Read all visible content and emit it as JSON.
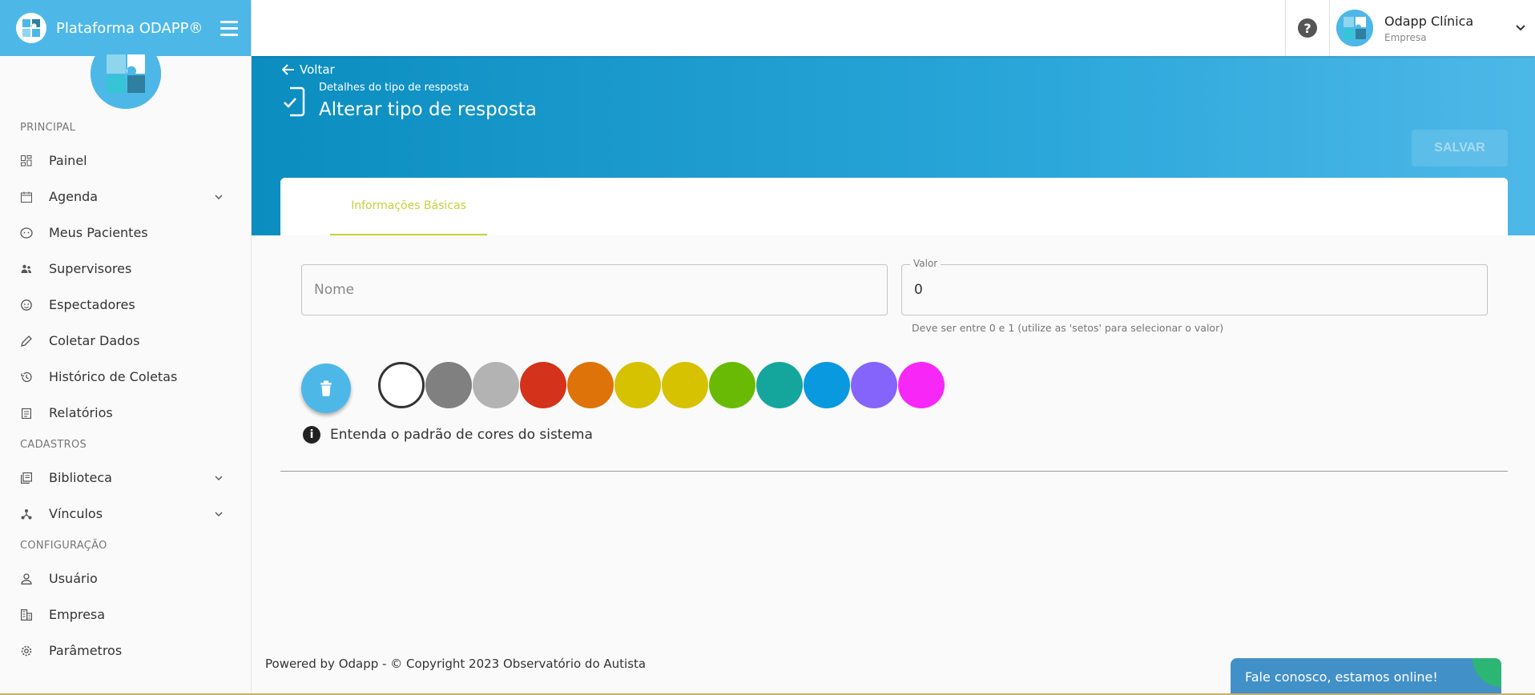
{
  "brand": {
    "title": "Plataforma ODAPP®"
  },
  "sidebar": {
    "sections": [
      {
        "title": "PRINCIPAL",
        "items": [
          {
            "label": "Painel",
            "icon": "dashboard-icon",
            "expandable": false
          },
          {
            "label": "Agenda",
            "icon": "calendar-icon",
            "expandable": true
          },
          {
            "label": "Meus Pacientes",
            "icon": "face-icon",
            "expandable": false
          },
          {
            "label": "Supervisores",
            "icon": "people-icon",
            "expandable": false
          },
          {
            "label": "Espectadores",
            "icon": "smile-icon",
            "expandable": false
          },
          {
            "label": "Coletar Dados",
            "icon": "pencil-icon",
            "expandable": false
          },
          {
            "label": "Histórico de Coletas",
            "icon": "history-icon",
            "expandable": false
          },
          {
            "label": "Relatórios",
            "icon": "report-icon",
            "expandable": false
          }
        ]
      },
      {
        "title": "CADASTROS",
        "items": [
          {
            "label": "Biblioteca",
            "icon": "library-icon",
            "expandable": true
          },
          {
            "label": "Vínculos",
            "icon": "hub-icon",
            "expandable": true
          }
        ]
      },
      {
        "title": "CONFIGURAÇÃO",
        "items": [
          {
            "label": "Usuário",
            "icon": "user-icon",
            "expandable": false
          },
          {
            "label": "Empresa",
            "icon": "building-icon",
            "expandable": false
          },
          {
            "label": "Parâmetros",
            "icon": "gear-icon",
            "expandable": false
          }
        ]
      }
    ]
  },
  "topbar": {
    "help": "?",
    "user_name": "Odapp Clínica",
    "user_role": "Empresa"
  },
  "header": {
    "back_label": "Voltar",
    "subtitle": "Detalhes do tipo de resposta",
    "title": "Alterar tipo de resposta",
    "save_label": "SALVAR"
  },
  "form": {
    "tab_label": "Informações Básicas",
    "name_placeholder": "Nome",
    "name_value": "",
    "valor_legend": "Valor",
    "valor_value": "0",
    "valor_help": "Deve ser entre 0 e 1 (utilize as 'setos' para selecionar o valor)",
    "info_label": "Entenda o padrão de cores do sistema",
    "info_glyph": "i"
  },
  "colors": {
    "accent": "#4db8e8",
    "tab_active": "#c4d23a",
    "swatches": [
      "#ffffff",
      "#808080",
      "#b3b3b3",
      "#d4321a",
      "#de7309",
      "#d6c201",
      "#d6c201",
      "#69ba04",
      "#14a69c",
      "#0999df",
      "#8564fb",
      "#f728f7"
    ]
  },
  "footer": {
    "text": "Powered by Odapp - © Copyright 2023 Observatório do Autista",
    "chat_label": "Fale conosco, estamos online!"
  }
}
